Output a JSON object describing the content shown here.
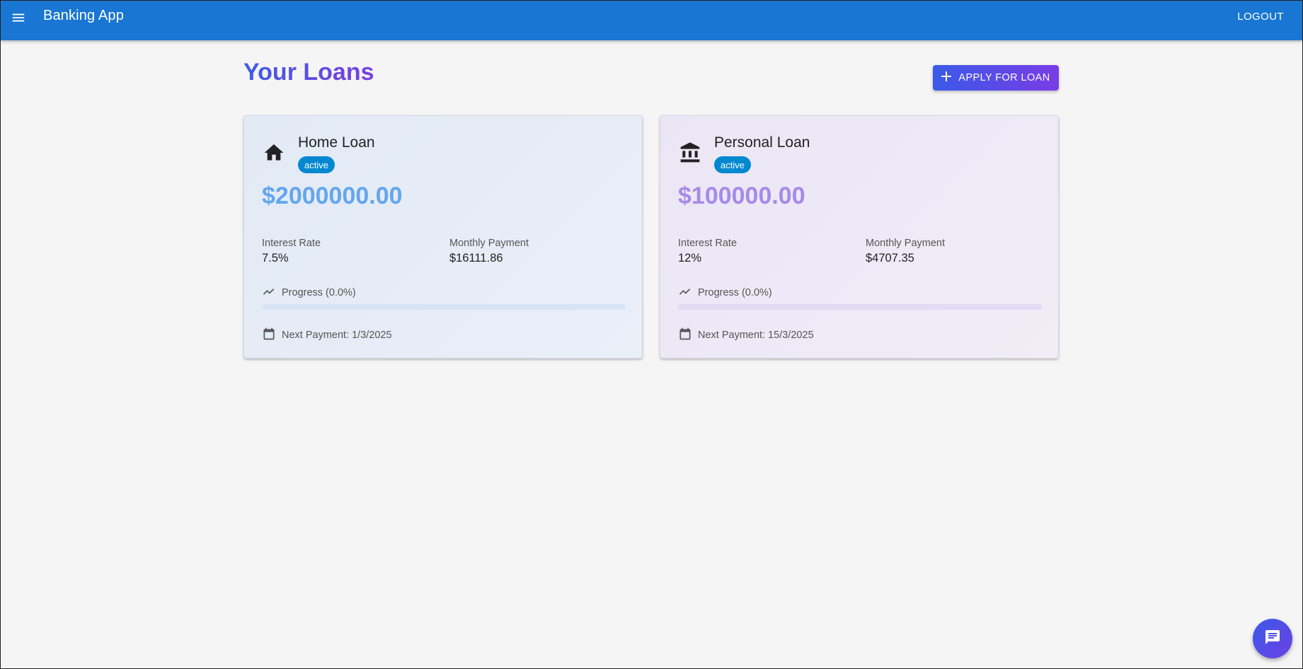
{
  "app": {
    "title": "Banking App",
    "logout_label": "LOGOUT"
  },
  "page": {
    "title": "Your Loans",
    "apply_label": "APPLY FOR LOAN"
  },
  "loans": [
    {
      "name": "Home Loan",
      "icon": "home-icon",
      "status": "active",
      "amount": "$2000000.00",
      "interest_label": "Interest Rate",
      "interest_rate": "7.5%",
      "monthly_label": "Monthly Payment",
      "monthly_payment": "$16111.86",
      "progress_label": "Progress (0.0%)",
      "progress_percent": 0,
      "next_payment": "Next Payment: 1/3/2025"
    },
    {
      "name": "Personal Loan",
      "icon": "bank-icon",
      "status": "active",
      "amount": "$100000.00",
      "interest_label": "Interest Rate",
      "interest_rate": "12%",
      "monthly_label": "Monthly Payment",
      "monthly_payment": "$4707.35",
      "progress_label": "Progress (0.0%)",
      "progress_percent": 0,
      "next_payment": "Next Payment: 15/3/2025"
    }
  ],
  "colors": {
    "appbar": "#1976d2",
    "badge": "#0288d1",
    "home_amount": "#64a6ee",
    "personal_amount": "#a58be8"
  }
}
